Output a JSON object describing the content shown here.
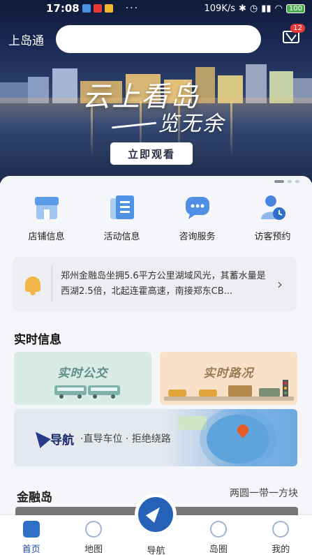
{
  "status_bar": {
    "time": "17:08",
    "dots": "···",
    "network_speed": "109K/s",
    "battery": "100"
  },
  "header": {
    "brand": "上岛通",
    "search_placeholder": "",
    "mail_badge": "12"
  },
  "banner": {
    "slogan_line1": "云上看岛",
    "slogan_line2": "览无余",
    "button_label": "立即观看"
  },
  "quick_entries": [
    {
      "label": "店铺信息",
      "icon": "shop-icon",
      "color": "#6aa7e6"
    },
    {
      "label": "活动信息",
      "icon": "document-icon",
      "color": "#5b9fe8"
    },
    {
      "label": "咨询服务",
      "icon": "chat-icon",
      "color": "#4f8fe6"
    },
    {
      "label": "访客预约",
      "icon": "visitor-icon",
      "color": "#4a86e0"
    }
  ],
  "notice": {
    "text": "郑州金融岛坐拥5.6平方公里湖域风光，其蓄水量是西湖2.5倍，北起连霍高速，南接郑东CB..."
  },
  "realtime": {
    "title": "实时信息",
    "bus_label": "实时公交",
    "road_label": "实时路况",
    "nav_label": "导航",
    "nav_subtitle": "·直导车位 · 拒绝绕路"
  },
  "island": {
    "title": "金融岛",
    "subtitle": "两圆一带一方块"
  },
  "tabbar": {
    "items": [
      {
        "label": "首页",
        "icon": "home-icon",
        "active": true
      },
      {
        "label": "地图",
        "icon": "map-pin-icon",
        "active": false
      },
      {
        "label": "导航",
        "icon": "navigation-icon",
        "active": false
      },
      {
        "label": "岛圈",
        "icon": "circle-icon",
        "active": false
      },
      {
        "label": "我的",
        "icon": "profile-icon",
        "active": false
      }
    ]
  },
  "colors": {
    "primary": "#2663b8",
    "active_tab": "#1d4fb0",
    "notice_bell": "#f0b64a",
    "badge": "#e53935"
  }
}
